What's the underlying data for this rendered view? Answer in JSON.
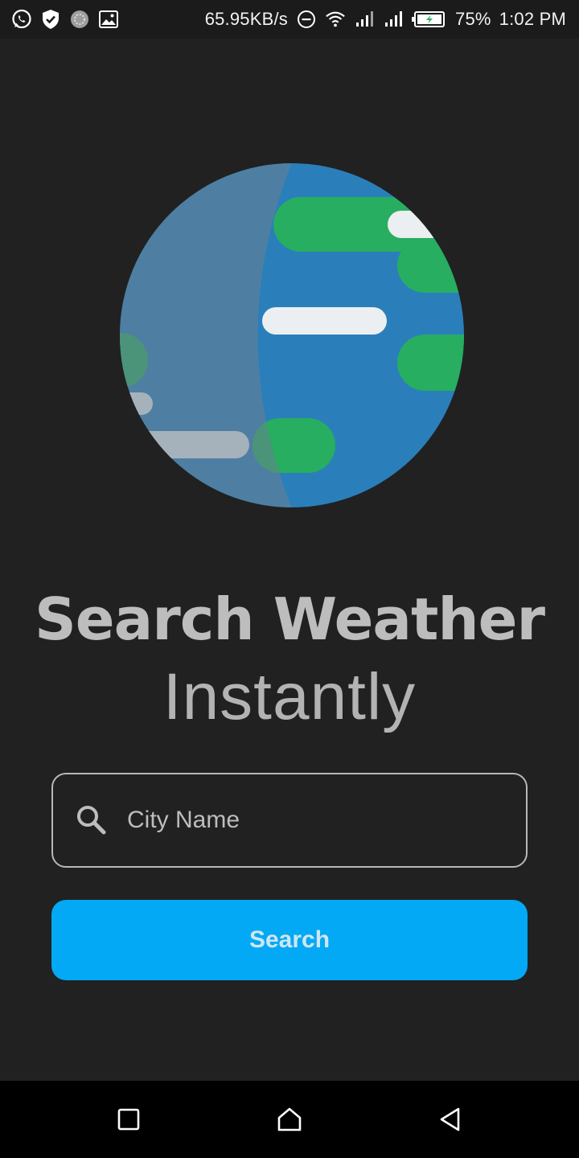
{
  "status_bar": {
    "left_icons": [
      "whatsapp-icon",
      "shield-check-icon",
      "sync-icon",
      "image-icon"
    ],
    "network_speed": "65.95KB/s",
    "right_icons": [
      "do-not-disturb-icon",
      "wifi-icon",
      "signal-icon",
      "signal-icon",
      "battery-charging-icon"
    ],
    "battery_percent": "75%",
    "time": "1:02 PM"
  },
  "hero": {
    "icon": "globe-weather-icon",
    "colors": {
      "ocean": "#2a7fbb",
      "land": "#27ae60",
      "cloud": "#eceff1",
      "shadow": "#4a6f8c"
    }
  },
  "headline": {
    "title": "Search Weather",
    "subtitle": "Instantly"
  },
  "search": {
    "icon": "search-icon",
    "placeholder": "City Name",
    "value": "",
    "button_label": "Search"
  },
  "colors": {
    "background": "#212121",
    "accent": "#03a9f4",
    "text": "#bdbdbd"
  },
  "nav_bar": {
    "buttons": [
      "recents-square-icon",
      "home-icon",
      "back-triangle-icon"
    ]
  }
}
